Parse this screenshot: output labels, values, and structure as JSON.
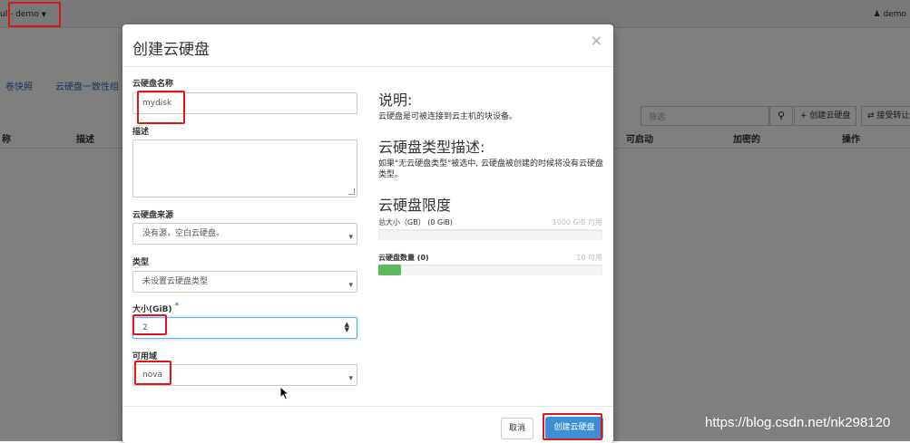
{
  "topbar": {
    "project_label": "ul - demo",
    "user_label": "demo"
  },
  "tabs": [
    "卷快照",
    "云硬盘一致性组"
  ],
  "toolbar": {
    "filter_placeholder": "筛选",
    "create_button": "+ 创建云硬盘",
    "accept_transfer_button": "⇄ 接受转让"
  },
  "table": {
    "headers": [
      "称",
      "描述",
      "可启动",
      "加密的",
      "操作"
    ]
  },
  "modal": {
    "title": "创建云硬盘",
    "close": "×",
    "fields": {
      "name_label": "云硬盘名称",
      "name_value": "mydisk",
      "description_label": "描述",
      "description_value": "",
      "source_label": "云硬盘来源",
      "source_value": "没有源，空白云硬盘。",
      "type_label": "类型",
      "type_value": "未设置云硬盘类型",
      "size_label": "大小(GiB)",
      "size_required": "*",
      "size_value": "2",
      "az_label": "可用域",
      "az_value": "nova"
    },
    "help": {
      "h_desc": "说明:",
      "p_desc": "云硬盘是可被连接到云主机的块设备。",
      "h_type": "云硬盘类型描述:",
      "p_type": "如果\"无云硬盘类型\"被选中, 云硬盘被创建的时候将没有云硬盘类型。",
      "h_limits": "云硬盘限度",
      "size_total_label": "总大小（GB） (0 GiB)",
      "size_available": "1000 GiB 可用",
      "size_fraction": 0.0,
      "count_label": "云硬盘数量 (0)",
      "count_available": "10 可用",
      "count_fraction": 0.1
    },
    "buttons": {
      "cancel": "取消",
      "submit": "创建云硬盘"
    }
  },
  "watermark": "https://blog.csdn.net/nk298120",
  "colors": {
    "primary": "#3b8fd4",
    "highlight": "#e3141b",
    "bar_fill": "#5cb85c"
  }
}
